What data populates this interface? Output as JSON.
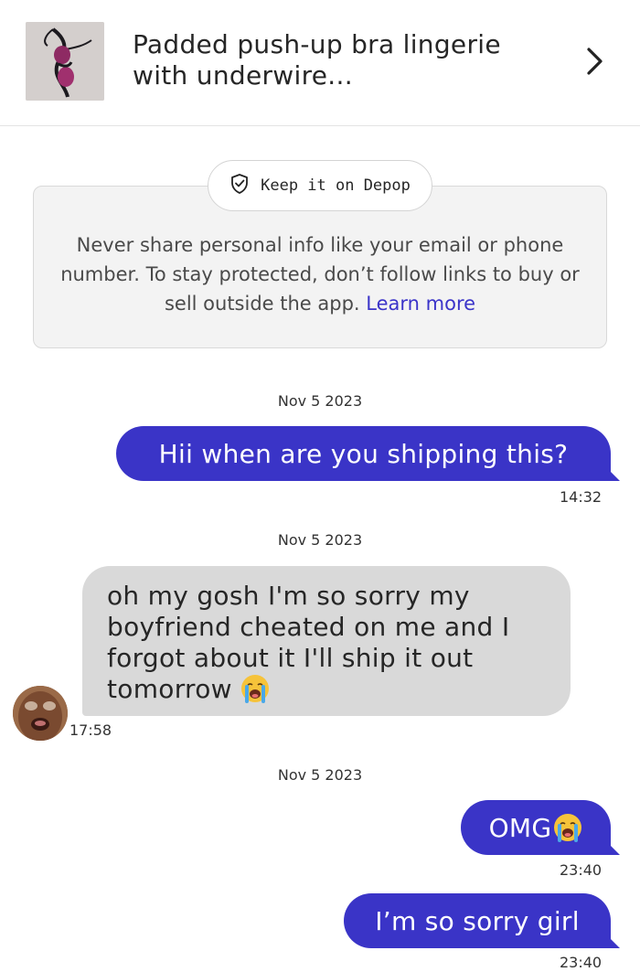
{
  "header": {
    "title_line1": "Padded push-up bra lingerie",
    "title_line2": "with underwire..."
  },
  "notice": {
    "badge_label": "Keep it on Depop",
    "body": "Never share personal info like your email or phone number. To stay protected, don’t follow links to buy or sell outside the app.",
    "learn_more": "Learn more"
  },
  "messages": [
    {
      "date": "Nov 5 2023",
      "sender": "me",
      "text": "Hii when are you shipping this?",
      "time": "14:32"
    },
    {
      "date": "Nov 5 2023",
      "sender": "other",
      "lines": [
        "oh my gosh I'm so sorry my",
        "boyfriend cheated on me and I",
        "forgot about it I'll ship it out",
        "tomorrow"
      ],
      "emoji": "loudly-crying-face",
      "time": "17:58"
    },
    {
      "date": "Nov 5 2023",
      "sender": "me",
      "text": "OMG",
      "emoji": "loudly-crying-face",
      "time": "23:40"
    },
    {
      "sender": "me",
      "text": "I’m so sorry girl",
      "time": "23:40"
    }
  ],
  "colors": {
    "accent": "#3a34c7",
    "incoming_bubble": "#d9d9d9",
    "link": "#3b34c9"
  }
}
